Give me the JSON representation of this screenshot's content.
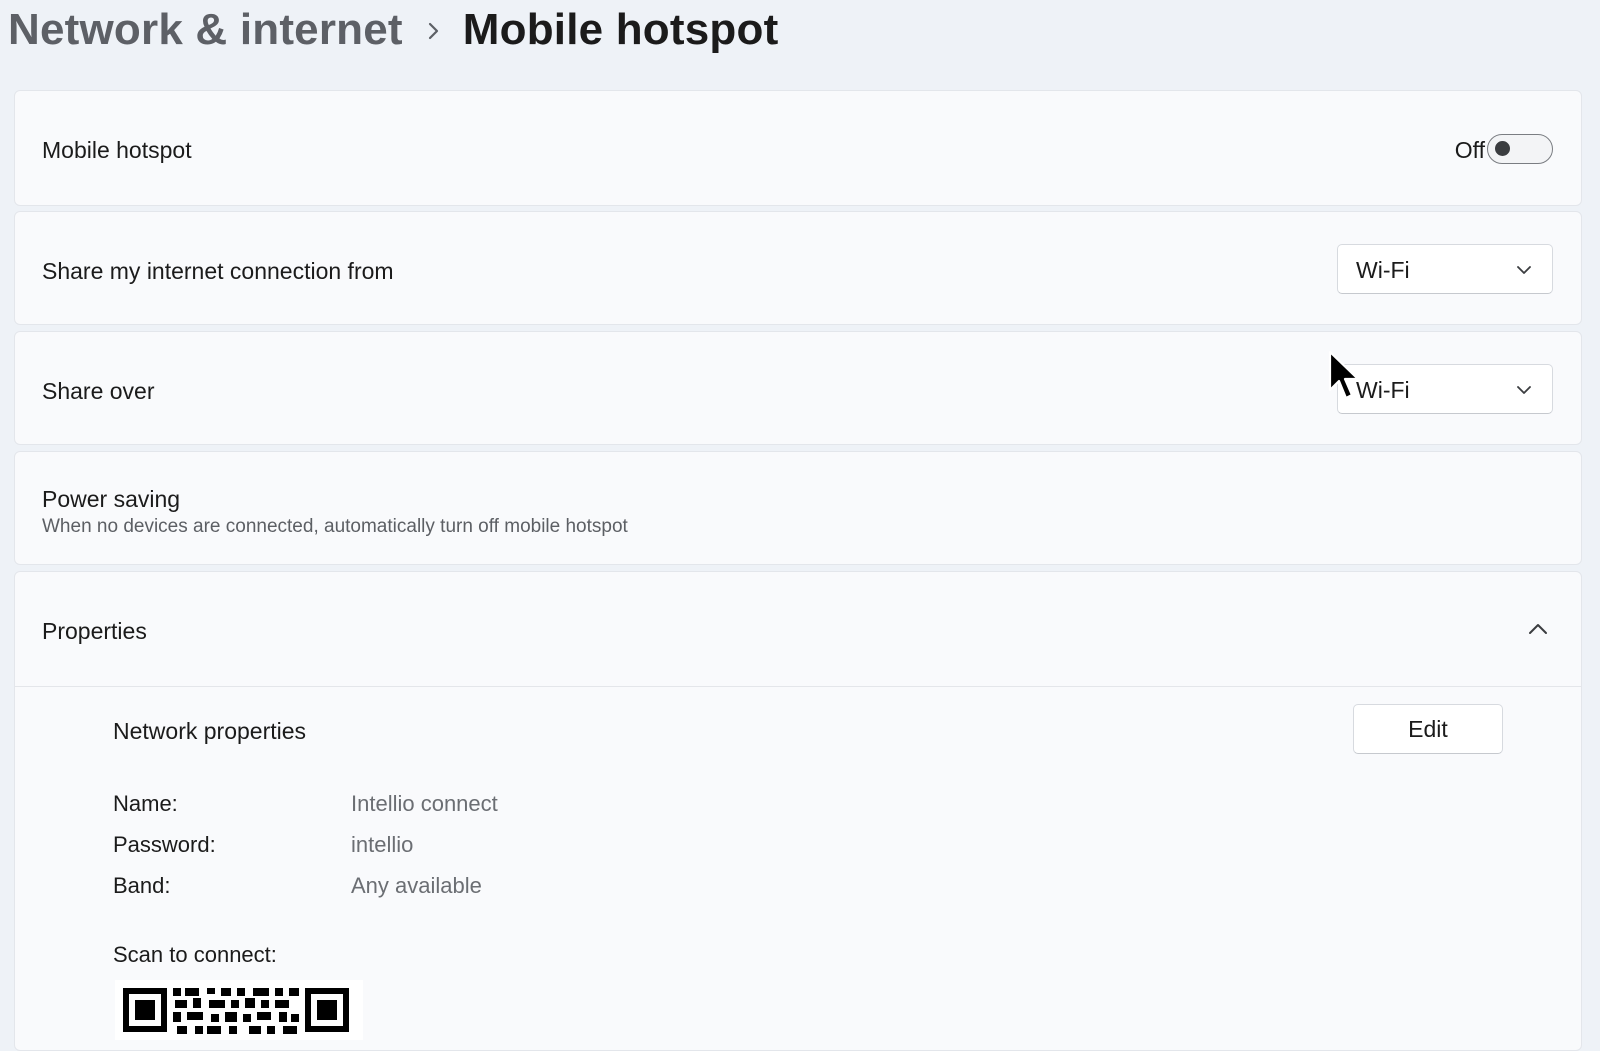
{
  "breadcrumb": {
    "parent": "Network & internet",
    "current": "Mobile hotspot"
  },
  "hotspot": {
    "label": "Mobile hotspot",
    "state": "Off",
    "on": false
  },
  "share_from": {
    "label": "Share my internet connection from",
    "value": "Wi-Fi"
  },
  "share_over": {
    "label": "Share over",
    "value": "Wi-Fi"
  },
  "power_saving": {
    "label": "Power saving",
    "description": "When no devices are connected, automatically turn off mobile hotspot"
  },
  "properties": {
    "label": "Properties",
    "expanded": true,
    "network_properties_label": "Network properties",
    "edit_label": "Edit",
    "fields": [
      {
        "label": "Name:",
        "value": "Intellio connect"
      },
      {
        "label": "Password:",
        "value": "intellio"
      },
      {
        "label": "Band:",
        "value": "Any available"
      }
    ],
    "scan_label": "Scan to connect:"
  },
  "icons": {
    "breadcrumb_separator": "chevron-right-icon",
    "dropdown": "chevron-down-icon",
    "collapse": "chevron-up-icon",
    "qr": "qr-code-icon",
    "cursor": "mouse-pointer-icon"
  }
}
